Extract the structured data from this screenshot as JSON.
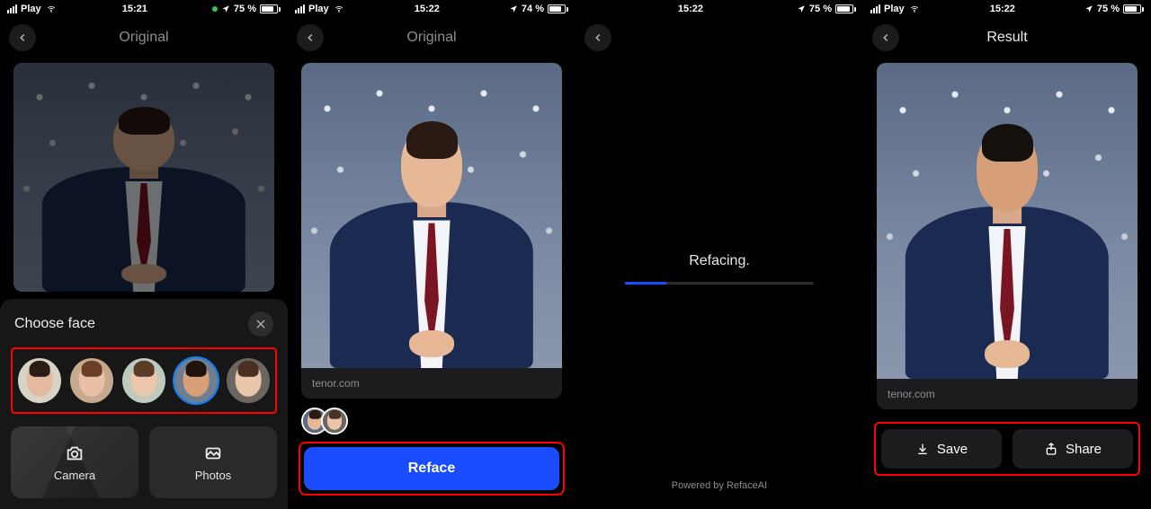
{
  "panes": [
    {
      "status": {
        "carrier": "Play",
        "time": "15:21",
        "battery_pct": "75 %",
        "battery_fill": 75,
        "show_green_dot": true,
        "battery_pct_prefix": ""
      },
      "nav_title": "Original",
      "sheet": {
        "title": "Choose face",
        "faces": [
          {
            "bg": "#d9d3c6",
            "skin": "#e4b9a0",
            "hair": "#2a1d15",
            "selected": false
          },
          {
            "bg": "#c7a98f",
            "skin": "#e9c0a4",
            "hair": "#6a3f25",
            "selected": false
          },
          {
            "bg": "#bfcabf",
            "skin": "#eac7ad",
            "hair": "#5a3b28",
            "selected": false
          },
          {
            "bg": "#6f7e90",
            "skin": "#d79f78",
            "hair": "#1e130d",
            "selected": true
          },
          {
            "bg": "#6b6660",
            "skin": "#e9c6ab",
            "hair": "#4a3021",
            "selected": false
          }
        ],
        "camera_label": "Camera",
        "photos_label": "Photos"
      }
    },
    {
      "status": {
        "carrier": "Play",
        "time": "15:22",
        "battery_pct": "74 %",
        "battery_fill": 74,
        "show_green_dot": false,
        "battery_pct_prefix": ""
      },
      "nav_title": "Original",
      "image_caption": "tenor.com",
      "pair": [
        {
          "skin": "#e6b896",
          "hair": "#2b1a14",
          "bg": "#5a6a85"
        },
        {
          "skin": "#e9c6ab",
          "hair": "#4a3021",
          "bg": "#6b6660"
        }
      ],
      "reface_label": "Reface"
    },
    {
      "status": {
        "carrier": "",
        "time": "15:22",
        "battery_pct": "75 %",
        "battery_fill": 75,
        "show_green_dot": false,
        "battery_pct_prefix": ""
      },
      "loading_text": "Refacing.",
      "progress_pct": 22,
      "powered_text": "Powered by RefaceAI"
    },
    {
      "status": {
        "carrier": "Play",
        "time": "15:22",
        "battery_pct": "75 %",
        "battery_fill": 75,
        "show_green_dot": false,
        "battery_pct_prefix": ""
      },
      "nav_title": "Result",
      "image_caption": "tenor.com",
      "save_label": "Save",
      "share_label": "Share"
    }
  ]
}
